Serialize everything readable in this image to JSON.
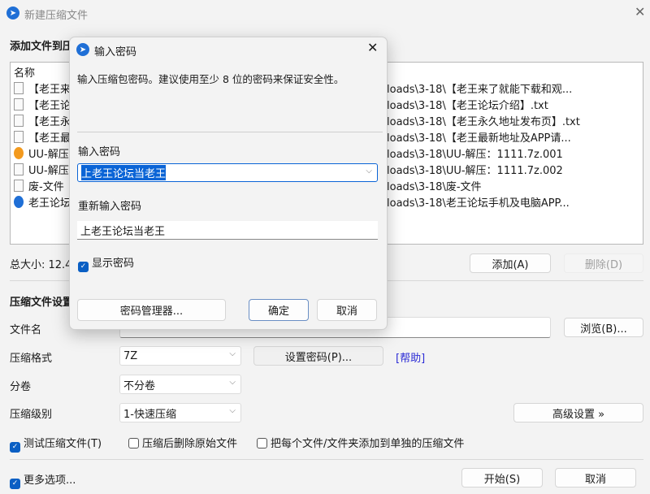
{
  "window": {
    "title": "新建压缩文件",
    "close_icon": "close-icon"
  },
  "files": {
    "section_title": "添加文件到压",
    "column_name": "名称",
    "rows": [
      {
        "name": "【老王来",
        "path": "loads\\3-18\\【老王来了就能下载和观...",
        "icon": "text-file-icon"
      },
      {
        "name": "【老王论",
        "path": "loads\\3-18\\【老王论坛介绍】.txt",
        "icon": "text-file-icon"
      },
      {
        "name": "【老王永",
        "path": "loads\\3-18\\【老王永久地址发布页】.txt",
        "icon": "text-file-icon"
      },
      {
        "name": "【老王最",
        "path": "loads\\3-18\\【老王最新地址及APP请...",
        "icon": "text-file-icon"
      },
      {
        "name": "UU-解压",
        "path": "loads\\3-18\\UU-解压：1111.7z.001",
        "icon": "archive-001-icon"
      },
      {
        "name": "UU-解压",
        "path": "loads\\3-18\\UU-解压：1111.7z.002",
        "icon": "blank-file-icon"
      },
      {
        "name": "废-文件",
        "path": "loads\\3-18\\废-文件",
        "icon": "blank-file-icon"
      },
      {
        "name": "老王论坛",
        "path": "loads\\3-18\\老王论坛手机及电脑APP...",
        "icon": "zip-archive-icon"
      }
    ],
    "total_size": "总大小: 12.4",
    "add_button": "添加(A)",
    "delete_button": "删除(D)"
  },
  "settings": {
    "section_title": "压缩文件设置",
    "filename_label": "文件名",
    "filename_value": "",
    "browse_button": "浏览(B)...",
    "format_label": "压缩格式",
    "format_value": "7Z",
    "set_password_button": "设置密码(P)...",
    "help_link": "[帮助]",
    "split_label": "分卷",
    "split_value": "不分卷",
    "level_label": "压缩级别",
    "level_value": "1-快速压缩",
    "advanced_button": "高级设置 »",
    "test_archive": {
      "label": "测试压缩文件(T)",
      "checked": true
    },
    "delete_after": {
      "label": "压缩后删除原始文件",
      "checked": false
    },
    "separate_archives": {
      "label": "把每个文件/文件夹添加到单独的压缩文件",
      "checked": false
    },
    "more_options": {
      "label": "更多选项...",
      "checked": true
    },
    "start_button": "开始(S)",
    "cancel_button": "取消"
  },
  "dialog": {
    "title": "输入密码",
    "description": "输入压缩包密码。建议使用至少 8 位的密码来保证安全性。",
    "password_label": "输入密码",
    "password_value": "上老王论坛当老王",
    "confirm_label": "重新输入密码",
    "confirm_value": "上老王论坛当老王",
    "show_password": {
      "label": "显示密码",
      "checked": true
    },
    "manager_button": "密码管理器...",
    "ok_button": "确定",
    "cancel_button": "取消"
  },
  "colors": {
    "accent": "#0a5fc4",
    "link": "#2b2bd6",
    "selection": "#0a64d6"
  }
}
